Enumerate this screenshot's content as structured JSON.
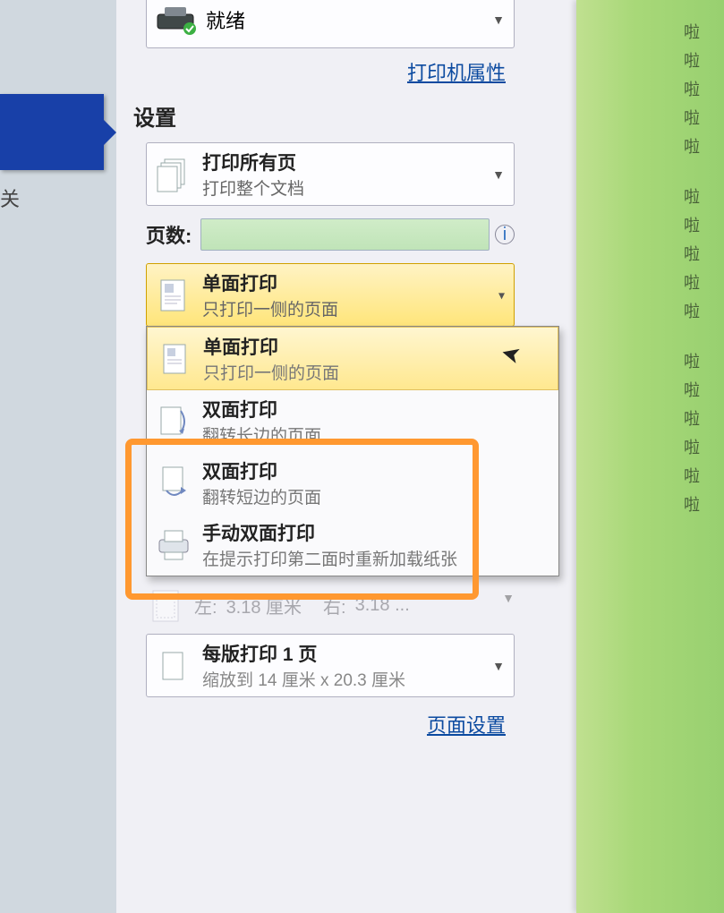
{
  "printer": {
    "status": "就绪",
    "properties_link": "打印机属性"
  },
  "settings_section": "设置",
  "print_range": {
    "title": "打印所有页",
    "sub": "打印整个文档"
  },
  "pages": {
    "label": "页数:",
    "value": ""
  },
  "duplex_selected": {
    "title": "单面打印",
    "sub": "只打印一侧的页面"
  },
  "duplex_options": [
    {
      "title": "单面打印",
      "sub": "只打印一侧的页面",
      "icon": "page-single"
    },
    {
      "title": "双面打印",
      "sub": "翻转长边的页面",
      "icon": "page-flip-long"
    },
    {
      "title": "双面打印",
      "sub": "翻转短边的页面",
      "icon": "page-flip-short"
    },
    {
      "title": "手动双面打印",
      "sub": "在提示打印第二面时重新加载纸张",
      "icon": "printer-manual"
    }
  ],
  "margins": {
    "left_label": "左:",
    "left_value": "3.18 厘米",
    "right_label": "右:",
    "right_value": "3.18 ..."
  },
  "per_sheet": {
    "title": "每版打印 1 页",
    "sub": "缩放到 14 厘米 x 20.3 厘米"
  },
  "page_setup_link": "页面设置",
  "left_x": "关",
  "preview_lines": [
    "啦",
    "啦",
    "啦",
    "啦",
    "啦",
    "",
    "啦",
    "啦",
    "啦",
    "啦",
    "啦",
    "",
    "啦",
    "啦",
    "啦",
    "啦",
    "啦",
    "啦"
  ]
}
